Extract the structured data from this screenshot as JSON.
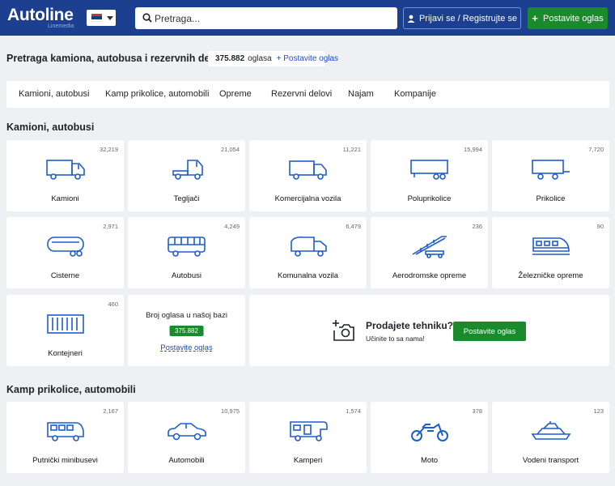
{
  "header": {
    "logo": "Autoline",
    "logo_sub": "Linemedia",
    "flag_colors": [
      "#c6363c",
      "#0c4076",
      "#ffffff"
    ],
    "search_placeholder": "Pretraga...",
    "login_label": "Prijavi se / Registrujte se",
    "post_label": "Postavite oglas"
  },
  "title_row": {
    "title": "Pretraga kamiona, autobusa i rezervnih delova",
    "count": "375.882",
    "count_word": "oglasa",
    "post_link": "+ Postavite oglas"
  },
  "tabs": [
    "Kamioni, autobusi",
    "Kamp prikolice, automobili",
    "Opreme",
    "Rezervni delovi",
    "Najam",
    "Kompanije"
  ],
  "sections": [
    {
      "title": "Kamioni, autobusi",
      "cards": [
        {
          "label": "Kamioni",
          "count": "32,219",
          "icon": "truck-icon"
        },
        {
          "label": "Tegljači",
          "count": "21,054",
          "icon": "tractor-unit-icon"
        },
        {
          "label": "Komercijalna vozila",
          "count": "11,221",
          "icon": "van-truck-icon"
        },
        {
          "label": "Poluprikolice",
          "count": "15,994",
          "icon": "semi-trailer-icon"
        },
        {
          "label": "Prikolice",
          "count": "7,720",
          "icon": "trailer-icon"
        },
        {
          "label": "Cisterne",
          "count": "2,971",
          "icon": "tanker-icon"
        },
        {
          "label": "Autobusi",
          "count": "4,249",
          "icon": "bus-icon"
        },
        {
          "label": "Komunalna vozila",
          "count": "6,479",
          "icon": "garbage-truck-icon"
        },
        {
          "label": "Aerodromske opreme",
          "count": "236",
          "icon": "airport-stairs-icon"
        },
        {
          "label": "Železničke opreme",
          "count": "90",
          "icon": "train-icon"
        },
        {
          "label": "Kontejneri",
          "count": "460",
          "icon": "container-icon"
        }
      ]
    },
    {
      "title": "Kamp prikolice, automobili",
      "cards": [
        {
          "label": "Putnički minibusevi",
          "count": "2,167",
          "icon": "minibus-icon"
        },
        {
          "label": "Automobili",
          "count": "10,975",
          "icon": "car-icon"
        },
        {
          "label": "Kamperi",
          "count": "1,574",
          "icon": "camper-icon"
        },
        {
          "label": "Moto",
          "count": "378",
          "icon": "motorcycle-icon"
        },
        {
          "label": "Vodeni transport",
          "count": "123",
          "icon": "boat-icon"
        }
      ]
    }
  ],
  "stats_card": {
    "title": "Broj oglasa u našoj bazi",
    "count": "375.882",
    "link": "Postavite oglas"
  },
  "sell_card": {
    "question": "Prodajete tehniku?",
    "subtitle": "Učinite to sa nama!",
    "button": "Postavite oglas"
  },
  "colors": {
    "header_bg": "#1c3f8f",
    "accent_green": "#1a8a2c",
    "icon_blue": "#1f5ccc",
    "link_blue": "#1f4cc9"
  }
}
